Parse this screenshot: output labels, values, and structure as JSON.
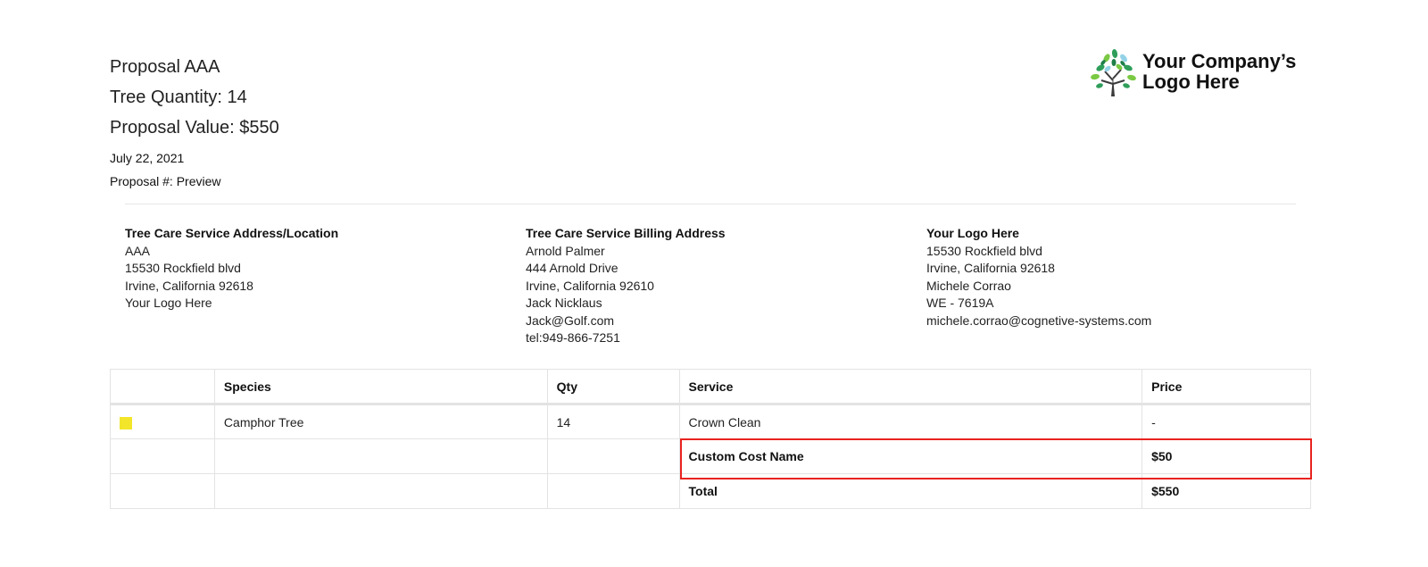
{
  "proposal": {
    "title": "Proposal AAA",
    "tree_quantity": "Tree Quantity: 14",
    "proposal_value": "Proposal Value: $550",
    "date": "July 22, 2021",
    "proposal_number": "Proposal #: Preview"
  },
  "logo": {
    "icon": "tree-icon",
    "text": "Your Company’s Logo Here"
  },
  "addresses": {
    "service": {
      "title": "Tree Care Service Address/Location",
      "lines": [
        "AAA",
        "15530 Rockfield blvd",
        "Irvine, California 92618",
        "Your Logo Here"
      ]
    },
    "billing": {
      "title": "Tree Care Service Billing Address",
      "lines": [
        "Arnold Palmer",
        "444 Arnold Drive",
        "Irvine, California 92610",
        "Jack Nicklaus",
        "Jack@Golf.com",
        "tel:949-866-7251"
      ]
    },
    "company": {
      "title": "Your Logo Here",
      "lines": [
        "15530 Rockfield blvd",
        "Irvine, California 92618",
        "Michele Corrao",
        "WE - 7619A",
        "michele.corrao@cognetive-systems.com"
      ]
    }
  },
  "table": {
    "headers": [
      "",
      "Species",
      "Qty",
      "Service",
      "Price"
    ],
    "rows": [
      {
        "swatch_color": "#f3e62a",
        "species": "Camphor Tree",
        "qty": "14",
        "service": "Crown Clean",
        "price": "-"
      },
      {
        "swatch_color": "",
        "species": "",
        "qty": "",
        "service": "Custom Cost Name",
        "price": "$50"
      },
      {
        "swatch_color": "",
        "species": "",
        "qty": "",
        "service": "Total",
        "price": "$550"
      }
    ]
  },
  "colors": {
    "highlight": "#e8231f",
    "swatch": "#f3e62a"
  }
}
